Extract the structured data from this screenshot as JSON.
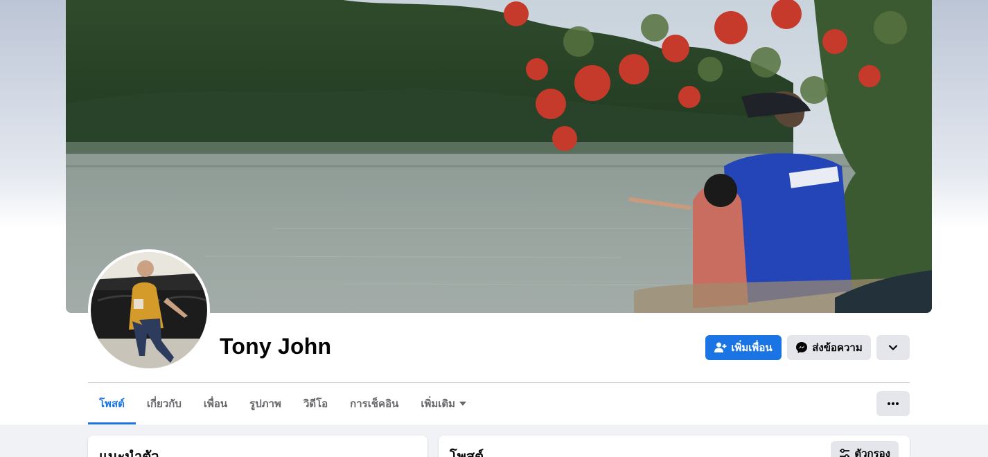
{
  "profile": {
    "name": "Tony John"
  },
  "actions": {
    "add_friend_label": "เพิ่มเพื่อน",
    "message_label": "ส่งข้อความ"
  },
  "tabs": [
    {
      "label": "โพสต์",
      "active": true
    },
    {
      "label": "เกี่ยวกับ"
    },
    {
      "label": "เพื่อน"
    },
    {
      "label": "รูปภาพ"
    },
    {
      "label": "วิดีโอ"
    },
    {
      "label": "การเช็คอิน"
    },
    {
      "label": "เพิ่มเติม"
    }
  ],
  "intro_card": {
    "title": "แนะนำตัว"
  },
  "posts_card": {
    "title": "โพสต์",
    "filter_label": "ตัวกรอง"
  },
  "colors": {
    "accent": "#1b74e4",
    "secondary_button": "#e4e6eb"
  },
  "icons": {
    "add_friend": "add-person-icon",
    "message": "messenger-icon",
    "more": "chevron-down-icon",
    "tab_overflow": "ellipsis-icon",
    "filter": "sliders-icon"
  }
}
